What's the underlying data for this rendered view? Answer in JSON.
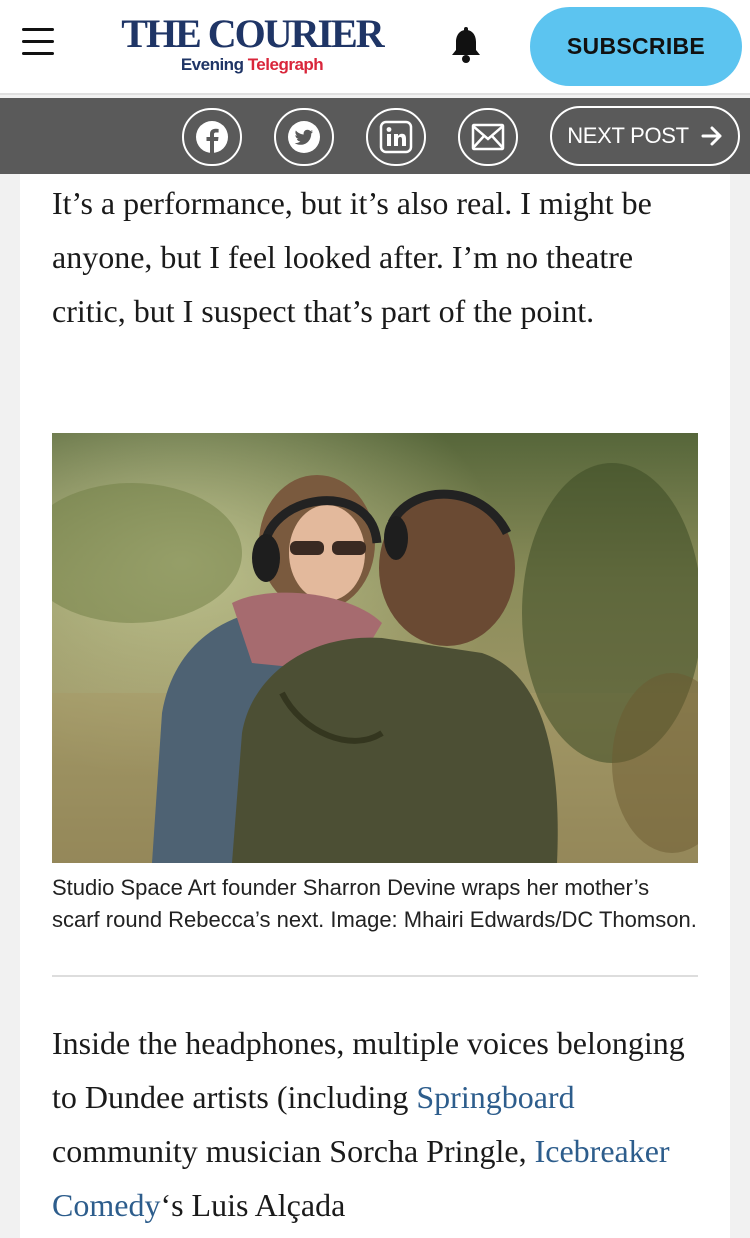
{
  "header": {
    "logo_main": "THE COURIER",
    "logo_sub_1": "Evening",
    "logo_sub_2": "Telegraph",
    "subscribe_label": "SUBSCRIBE",
    "icons": [
      "menu-icon",
      "bell-icon"
    ],
    "colors": {
      "brand_navy": "#1f3566",
      "brand_red": "#d9263b",
      "subscribe_bg": "#5cc4f0"
    }
  },
  "sharebar": {
    "icons": [
      "facebook-icon",
      "twitter-icon",
      "linkedin-icon",
      "email-icon",
      "arrow-right-icon"
    ],
    "next_post_label": "NEXT POST",
    "colors": {
      "bar_bg": "#5a5a5a"
    }
  },
  "article": {
    "para1": "It’s a performance, but it’s also real. I might be anyone, but I feel looked after. I’m no theatre critic, but I suspect that’s part of the point.",
    "caption": "Studio Space Art founder Sharron Devine wraps her mother’s scarf round Rebecca’s next. Image: Mhairi Edwards/DC Thomson.",
    "para2": {
      "t1": "Inside the headphones, multiple voices belonging to Dundee artists (including ",
      "link1": "Springboard",
      "t2": " community musician Sorcha Pringle, ",
      "link2": "Icebreaker Comedy",
      "t3": "‘s Luis Alçada"
    },
    "colors": {
      "link": "#2d5d8c"
    }
  }
}
